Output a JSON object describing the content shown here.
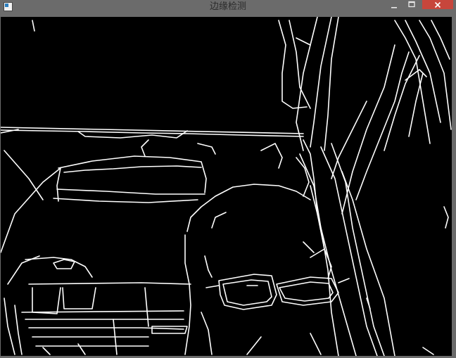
{
  "window": {
    "title": "边缘检测",
    "controls": {
      "minimize": "—",
      "maximize": "□",
      "close": "✕"
    }
  },
  "image": {
    "description_icon": "edge-map-image",
    "background_color": "#000000",
    "edge_color": "#ffffff"
  }
}
